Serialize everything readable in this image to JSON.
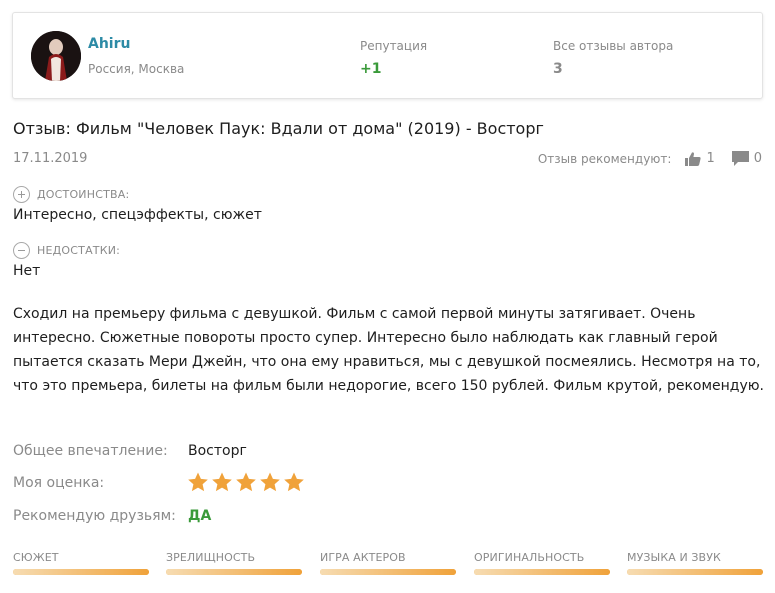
{
  "author": {
    "name": "Ahiru",
    "location": "Россия, Москва",
    "reputation_label": "Репутация",
    "reputation_value": "+1",
    "all_reviews_label": "Все отзывы автора",
    "all_reviews_value": "3"
  },
  "review": {
    "title": "Отзыв: Фильм \"Человек Паук: Вдали от дома\" (2019) - Восторг",
    "date": "17.11.2019",
    "recommend_label": "Отзыв рекомендуют:",
    "likes": "1",
    "comments": "0",
    "pros_label": "ДОСТОИНСТВА:",
    "pros": "Интересно, спецэффекты, сюжет",
    "cons_label": "НЕДОСТАТКИ:",
    "cons": "Нет",
    "body": "Сходил на премьеру фильма с девушкой. Фильм с самой первой минуты затягивает. Очень интересно. Сюжетные повороты просто супер. Интересно было наблюдать как главный герой пытается сказать Мери Джейн, что она ему нравиться, мы с девушкой посмеялись. Несмотря на то, что это премьера, билеты на фильм были недорогие, всего 150 рублей. Фильм крутой, рекомендую."
  },
  "summary": {
    "impression_label": "Общее впечатление:",
    "impression_value": "Восторг",
    "rating_label": "Моя оценка:",
    "rating": 5,
    "rating_max": 5,
    "recommend_label": "Рекомендую друзьям:",
    "recommend_value": "ДА"
  },
  "categories": [
    {
      "label": "СЮЖЕТ",
      "level": 1.0
    },
    {
      "label": "ЗРЕЛИЩНОСТЬ",
      "level": 1.0
    },
    {
      "label": "ИГРА АКТЕРОВ",
      "level": 1.0
    },
    {
      "label": "ОРИГИНАЛЬНОСТЬ",
      "level": 1.0
    },
    {
      "label": "МУЗЫКА И ЗВУК",
      "level": 1.0
    }
  ],
  "colors": {
    "accent_link": "#2d8ba6",
    "positive": "#3a9a3a",
    "star": "#f0a23a",
    "bar": "#f0a23a"
  },
  "icons": [
    "plus-circle-icon",
    "minus-circle-icon",
    "thumbs-up-icon",
    "comment-icon",
    "star-icon"
  ]
}
